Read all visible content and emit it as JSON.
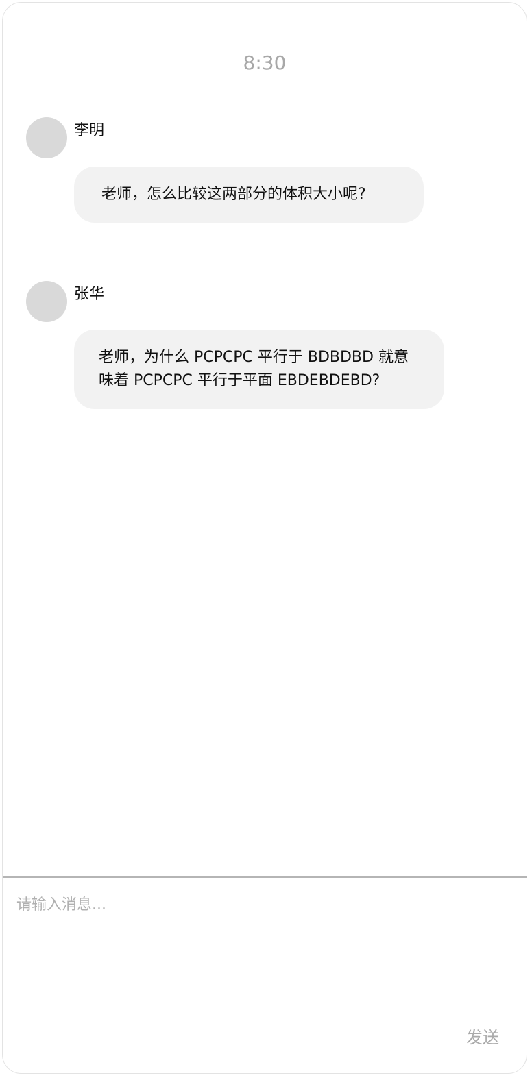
{
  "status_bar": {
    "time": "8:30"
  },
  "messages": [
    {
      "sender": "李明",
      "text": "老师，怎么比较这两部分的体积大小呢?"
    },
    {
      "sender": "张华",
      "text": "老师，为什么 PCPCPC 平行于 BDBDBD 就意味着 PCPCPC 平行于平面 EBDEBDEBD?"
    }
  ],
  "composer": {
    "placeholder": "请输入消息...",
    "value": "",
    "send_label": "发送"
  },
  "colors": {
    "bubble_bg": "#f2f2f2",
    "avatar_bg": "#d9d9d9",
    "muted_text": "#a8a8a8",
    "divider": "#b5b5b5"
  }
}
